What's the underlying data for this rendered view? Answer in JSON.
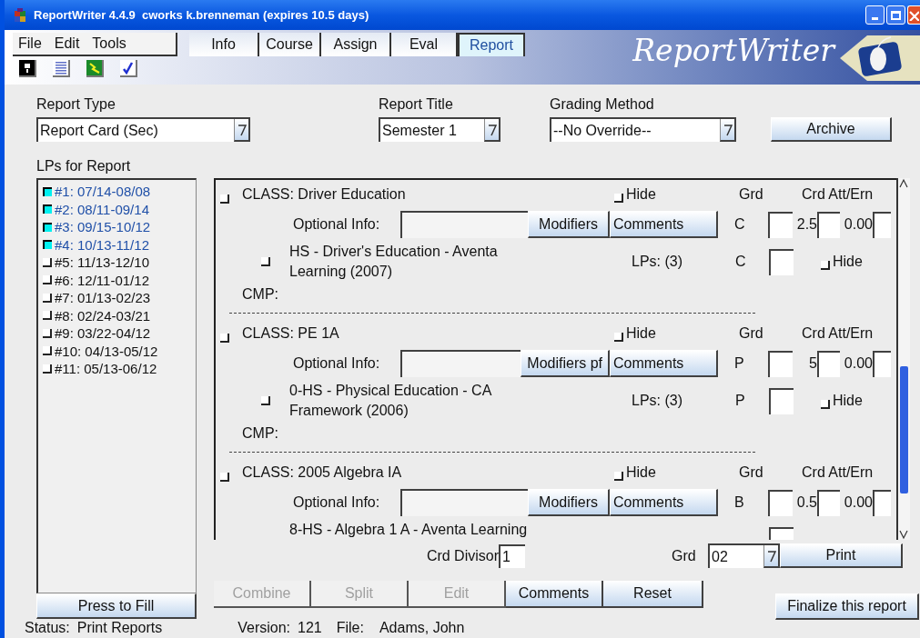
{
  "window": {
    "title": "ReportWriter 4.4.9  cworks k.brenneman (expires 10.5 days)"
  },
  "menu": [
    "File",
    "Edit",
    "Tools"
  ],
  "tabs": [
    {
      "label": "Info",
      "selected": false
    },
    {
      "label": "Course",
      "selected": false
    },
    {
      "label": "Assign",
      "selected": false
    },
    {
      "label": "Eval",
      "selected": false
    },
    {
      "label": "Report",
      "selected": true
    }
  ],
  "logo": "ReportWriter",
  "report_type": {
    "label": "Report Type",
    "value": "Report Card (Sec)"
  },
  "report_title": {
    "label": "Report Title",
    "value": "Semester 1"
  },
  "grading_method": {
    "label": "Grading Method",
    "value": "--No Override--"
  },
  "archive_button": "Archive",
  "lps": {
    "label": "LPs for Report",
    "items": [
      {
        "label": "#1: 07/14-08/08",
        "checked": true
      },
      {
        "label": "#2: 08/11-09/14",
        "checked": true
      },
      {
        "label": "#3: 09/15-10/12",
        "checked": true
      },
      {
        "label": "#4: 10/13-11/12",
        "checked": true
      },
      {
        "label": "#5: 11/13-12/10",
        "checked": false
      },
      {
        "label": "#6: 12/11-01/12",
        "checked": false
      },
      {
        "label": "#7: 01/13-02/23",
        "checked": false
      },
      {
        "label": "#8: 02/24-03/21",
        "checked": false
      },
      {
        "label": "#9: 03/22-04/12",
        "checked": false
      },
      {
        "label": "#10: 04/13-05/12",
        "checked": false
      },
      {
        "label": "#11: 05/13-06/12",
        "checked": false
      }
    ]
  },
  "press_to_fill": "Press to Fill",
  "classes": [
    {
      "title": "CLASS: Driver Education",
      "checked": false,
      "hide_label": "Hide",
      "hide": false,
      "grd_header": "Grd",
      "crd_header": "Crd Att/Ern",
      "optional_label": "Optional Info:",
      "modifiers": "Modifiers",
      "comments": "Comments",
      "grade": "C",
      "credits": "2.5",
      "earned": "0.00",
      "course": "HS - Driver's Education - Aventa Learning (2007)",
      "course_checked": false,
      "lps": "LPs: (3)",
      "course_grade": "C",
      "course_hide_label": "Hide",
      "course_hide": false,
      "cmp": "CMP:"
    },
    {
      "title": "CLASS: PE 1A",
      "checked": false,
      "hide_label": "Hide",
      "hide": false,
      "grd_header": "Grd",
      "crd_header": "Crd Att/Ern",
      "optional_label": "Optional Info:",
      "modifiers": "Modifiers pf",
      "comments": "Comments",
      "grade": "P",
      "credits": "5",
      "earned": "0.00",
      "course": "0-HS - Physical Education - CA Framework (2006)",
      "course_checked": false,
      "lps": "LPs: (3)",
      "course_grade": "P",
      "course_hide_label": "Hide",
      "course_hide": false,
      "cmp": "CMP:"
    },
    {
      "title": "CLASS: 2005 Algebra IA",
      "checked": false,
      "hide_label": "Hide",
      "hide": false,
      "grd_header": "Grd",
      "crd_header": "Crd Att/Ern",
      "optional_label": "Optional Info:",
      "modifiers": "Modifiers",
      "comments": "Comments",
      "grade": "B",
      "credits": "0.5",
      "earned": "0.00",
      "course": "8-HS - Algebra 1 A - Aventa Learning"
    }
  ],
  "crd_divisor": {
    "label": "Crd Divisor",
    "value": "1"
  },
  "grd": {
    "label": "Grd",
    "value": "02"
  },
  "print_button": "Print",
  "actions": [
    {
      "label": "Combine",
      "disabled": true
    },
    {
      "label": "Split",
      "disabled": true
    },
    {
      "label": "Edit",
      "disabled": true
    },
    {
      "label": "Comments",
      "disabled": false
    },
    {
      "label": "Reset",
      "disabled": false
    }
  ],
  "finalize_button": "Finalize this report",
  "status": {
    "label": "Status:",
    "value": "Print Reports"
  },
  "version": {
    "label": "Version:",
    "value": "121"
  },
  "file": {
    "label": "File:",
    "value": "Adams, John"
  }
}
